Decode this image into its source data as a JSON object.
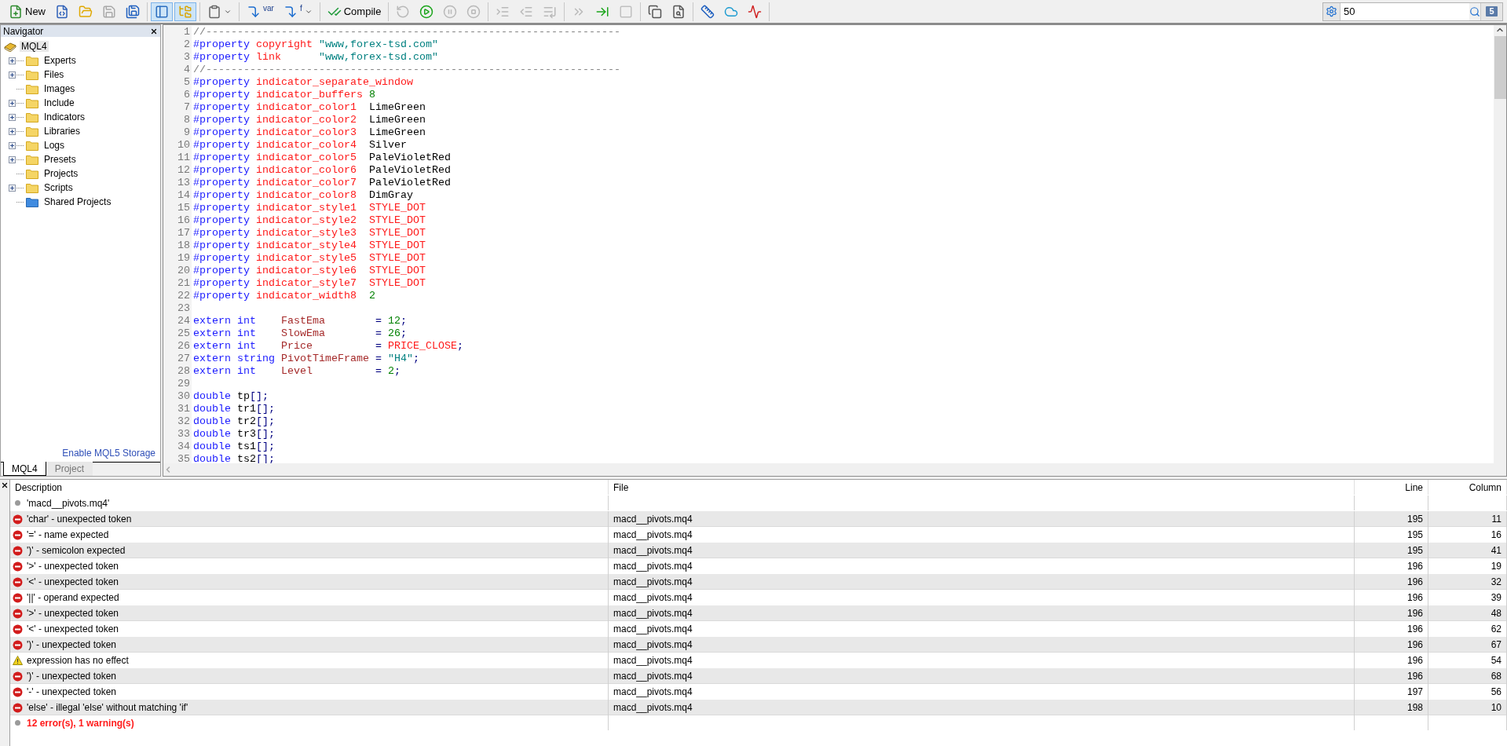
{
  "toolbar": {
    "groups": [
      [
        {
          "kind": "new",
          "label": "New",
          "selected": false,
          "disabled": false
        },
        {
          "kind": "new-project",
          "selected": false,
          "disabled": false
        },
        {
          "kind": "open",
          "selected": false,
          "disabled": false
        },
        {
          "kind": "save",
          "selected": false,
          "disabled": true
        },
        {
          "kind": "save-all",
          "selected": false,
          "disabled": false
        }
      ],
      [
        {
          "kind": "layout",
          "selected": true,
          "disabled": false
        },
        {
          "kind": "folders",
          "selected": true,
          "disabled": false
        }
      ],
      [
        {
          "kind": "clipboard",
          "menu": true,
          "selected": false,
          "disabled": false
        }
      ],
      [
        {
          "kind": "insert",
          "label": "var",
          "selected": false,
          "disabled": false
        },
        {
          "kind": "insert",
          "label": "f",
          "menu": true,
          "selected": false,
          "disabled": false
        }
      ],
      [
        {
          "kind": "compile",
          "label": "Compile",
          "selected": false,
          "disabled": false
        }
      ],
      [
        {
          "kind": "restart",
          "selected": false,
          "disabled": true
        },
        {
          "kind": "play",
          "selected": false,
          "disabled": false
        },
        {
          "kind": "pause",
          "selected": false,
          "disabled": true
        },
        {
          "kind": "stop",
          "selected": false,
          "disabled": true
        }
      ],
      [
        {
          "kind": "step-into",
          "selected": false,
          "disabled": true
        },
        {
          "kind": "step-over",
          "selected": false,
          "disabled": true
        },
        {
          "kind": "step-out",
          "selected": false,
          "disabled": true
        }
      ],
      [
        {
          "kind": "breakpoint",
          "selected": false,
          "disabled": true
        },
        {
          "kind": "run-to",
          "selected": false,
          "disabled": false
        },
        {
          "kind": "halt",
          "selected": false,
          "disabled": true
        }
      ],
      [
        {
          "kind": "copy",
          "selected": false,
          "disabled": false
        },
        {
          "kind": "find",
          "selected": false,
          "disabled": false
        }
      ],
      [
        {
          "kind": "comb",
          "selected": false,
          "disabled": false
        },
        {
          "kind": "cloud",
          "selected": false,
          "disabled": false
        },
        {
          "kind": "chart",
          "selected": false,
          "disabled": false
        }
      ]
    ],
    "search": {
      "value": "50"
    },
    "messages_badge": "5"
  },
  "navigator": {
    "title": "Navigator",
    "root": {
      "label": "MQL4",
      "selected": true
    },
    "items": [
      {
        "label": "Experts",
        "kind": "folder",
        "expandable": true,
        "selected": false
      },
      {
        "label": "Files",
        "kind": "folder",
        "expandable": true,
        "selected": false
      },
      {
        "label": "Images",
        "kind": "folder",
        "expandable": false,
        "selected": false
      },
      {
        "label": "Include",
        "kind": "folder",
        "expandable": true,
        "selected": false
      },
      {
        "label": "Indicators",
        "kind": "folder",
        "expandable": true,
        "selected": false
      },
      {
        "label": "Libraries",
        "kind": "folder",
        "expandable": true,
        "selected": false
      },
      {
        "label": "Logs",
        "kind": "folder",
        "expandable": true,
        "selected": false
      },
      {
        "label": "Presets",
        "kind": "folder",
        "expandable": true,
        "selected": false
      },
      {
        "label": "Projects",
        "kind": "folder",
        "expandable": false,
        "selected": false
      },
      {
        "label": "Scripts",
        "kind": "folder",
        "expandable": true,
        "selected": false
      },
      {
        "label": "Shared Projects",
        "kind": "shared",
        "expandable": false,
        "selected": false
      }
    ],
    "link": "Enable MQL5 Storage",
    "tabs": [
      {
        "label": "MQL4",
        "selected": true
      },
      {
        "label": "Project",
        "selected": false
      }
    ]
  },
  "editor": {
    "lines": [
      {
        "n": "1",
        "tokens": [
          {
            "kind": "comment",
            "text": "//------------------------------------------------------------------"
          }
        ]
      },
      {
        "n": "2",
        "tokens": [
          {
            "kind": "keyword",
            "text": "#property "
          },
          {
            "kind": "property",
            "text": "copyright "
          },
          {
            "kind": "string",
            "text": "\"www,forex-tsd.com\""
          }
        ]
      },
      {
        "n": "3",
        "tokens": [
          {
            "kind": "keyword",
            "text": "#property "
          },
          {
            "kind": "property",
            "text": "link      "
          },
          {
            "kind": "string",
            "text": "\"www,forex-tsd.com\""
          }
        ]
      },
      {
        "n": "4",
        "tokens": [
          {
            "kind": "comment",
            "text": "//------------------------------------------------------------------"
          }
        ]
      },
      {
        "n": "5",
        "tokens": [
          {
            "kind": "keyword",
            "text": "#property "
          },
          {
            "kind": "property",
            "text": "indicator_separate_window"
          }
        ]
      },
      {
        "n": "6",
        "tokens": [
          {
            "kind": "keyword",
            "text": "#property "
          },
          {
            "kind": "property",
            "text": "indicator_buffers "
          },
          {
            "kind": "number",
            "text": "8"
          }
        ]
      },
      {
        "n": "7",
        "tokens": [
          {
            "kind": "keyword",
            "text": "#property "
          },
          {
            "kind": "property",
            "text": "indicator_color1  "
          },
          {
            "kind": "plain",
            "text": "LimeGreen"
          }
        ]
      },
      {
        "n": "8",
        "tokens": [
          {
            "kind": "keyword",
            "text": "#property "
          },
          {
            "kind": "property",
            "text": "indicator_color2  "
          },
          {
            "kind": "plain",
            "text": "LimeGreen"
          }
        ]
      },
      {
        "n": "9",
        "tokens": [
          {
            "kind": "keyword",
            "text": "#property "
          },
          {
            "kind": "property",
            "text": "indicator_color3  "
          },
          {
            "kind": "plain",
            "text": "LimeGreen"
          }
        ]
      },
      {
        "n": "10",
        "tokens": [
          {
            "kind": "keyword",
            "text": "#property "
          },
          {
            "kind": "property",
            "text": "indicator_color4  "
          },
          {
            "kind": "plain",
            "text": "Silver"
          }
        ]
      },
      {
        "n": "11",
        "tokens": [
          {
            "kind": "keyword",
            "text": "#property "
          },
          {
            "kind": "property",
            "text": "indicator_color5  "
          },
          {
            "kind": "plain",
            "text": "PaleVioletRed"
          }
        ]
      },
      {
        "n": "12",
        "tokens": [
          {
            "kind": "keyword",
            "text": "#property "
          },
          {
            "kind": "property",
            "text": "indicator_color6  "
          },
          {
            "kind": "plain",
            "text": "PaleVioletRed"
          }
        ]
      },
      {
        "n": "13",
        "tokens": [
          {
            "kind": "keyword",
            "text": "#property "
          },
          {
            "kind": "property",
            "text": "indicator_color7  "
          },
          {
            "kind": "plain",
            "text": "PaleVioletRed"
          }
        ]
      },
      {
        "n": "14",
        "tokens": [
          {
            "kind": "keyword",
            "text": "#property "
          },
          {
            "kind": "property",
            "text": "indicator_color8  "
          },
          {
            "kind": "plain",
            "text": "DimGray"
          }
        ]
      },
      {
        "n": "15",
        "tokens": [
          {
            "kind": "keyword",
            "text": "#property "
          },
          {
            "kind": "property",
            "text": "indicator_style1  "
          },
          {
            "kind": "constant",
            "text": "STYLE_DOT"
          }
        ]
      },
      {
        "n": "16",
        "tokens": [
          {
            "kind": "keyword",
            "text": "#property "
          },
          {
            "kind": "property",
            "text": "indicator_style2  "
          },
          {
            "kind": "constant",
            "text": "STYLE_DOT"
          }
        ]
      },
      {
        "n": "17",
        "tokens": [
          {
            "kind": "keyword",
            "text": "#property "
          },
          {
            "kind": "property",
            "text": "indicator_style3  "
          },
          {
            "kind": "constant",
            "text": "STYLE_DOT"
          }
        ]
      },
      {
        "n": "18",
        "tokens": [
          {
            "kind": "keyword",
            "text": "#property "
          },
          {
            "kind": "property",
            "text": "indicator_style4  "
          },
          {
            "kind": "constant",
            "text": "STYLE_DOT"
          }
        ]
      },
      {
        "n": "19",
        "tokens": [
          {
            "kind": "keyword",
            "text": "#property "
          },
          {
            "kind": "property",
            "text": "indicator_style5  "
          },
          {
            "kind": "constant",
            "text": "STYLE_DOT"
          }
        ]
      },
      {
        "n": "20",
        "tokens": [
          {
            "kind": "keyword",
            "text": "#property "
          },
          {
            "kind": "property",
            "text": "indicator_style6  "
          },
          {
            "kind": "constant",
            "text": "STYLE_DOT"
          }
        ]
      },
      {
        "n": "21",
        "tokens": [
          {
            "kind": "keyword",
            "text": "#property "
          },
          {
            "kind": "property",
            "text": "indicator_style7  "
          },
          {
            "kind": "constant",
            "text": "STYLE_DOT"
          }
        ]
      },
      {
        "n": "22",
        "tokens": [
          {
            "kind": "keyword",
            "text": "#property "
          },
          {
            "kind": "property",
            "text": "indicator_width8  "
          },
          {
            "kind": "number",
            "text": "2"
          }
        ]
      },
      {
        "n": "23"
      },
      {
        "n": "24",
        "tokens": [
          {
            "kind": "keyword",
            "text": "extern int    "
          },
          {
            "kind": "identifier",
            "text": "FastEma        "
          },
          {
            "kind": "operator",
            "text": "= "
          },
          {
            "kind": "number",
            "text": "12"
          },
          {
            "kind": "operator",
            "text": ";"
          }
        ]
      },
      {
        "n": "25",
        "tokens": [
          {
            "kind": "keyword",
            "text": "extern int    "
          },
          {
            "kind": "identifier",
            "text": "SlowEma        "
          },
          {
            "kind": "operator",
            "text": "= "
          },
          {
            "kind": "number",
            "text": "26"
          },
          {
            "kind": "operator",
            "text": ";"
          }
        ]
      },
      {
        "n": "26",
        "tokens": [
          {
            "kind": "keyword",
            "text": "extern int    "
          },
          {
            "kind": "identifier",
            "text": "Price          "
          },
          {
            "kind": "operator",
            "text": "= "
          },
          {
            "kind": "constant",
            "text": "PRICE_CLOSE"
          },
          {
            "kind": "operator",
            "text": ";"
          }
        ]
      },
      {
        "n": "27",
        "tokens": [
          {
            "kind": "keyword",
            "text": "extern string "
          },
          {
            "kind": "identifier",
            "text": "PivotTimeFrame "
          },
          {
            "kind": "operator",
            "text": "= "
          },
          {
            "kind": "string",
            "text": "\"H4\""
          },
          {
            "kind": "operator",
            "text": ";"
          }
        ]
      },
      {
        "n": "28",
        "tokens": [
          {
            "kind": "keyword",
            "text": "extern int    "
          },
          {
            "kind": "identifier",
            "text": "Level          "
          },
          {
            "kind": "operator",
            "text": "= "
          },
          {
            "kind": "number",
            "text": "2"
          },
          {
            "kind": "operator",
            "text": ";"
          }
        ]
      },
      {
        "n": "29"
      },
      {
        "n": "30",
        "tokens": [
          {
            "kind": "keyword",
            "text": "double "
          },
          {
            "kind": "plain",
            "text": "tp"
          },
          {
            "kind": "operator",
            "text": "[];"
          }
        ]
      },
      {
        "n": "31",
        "tokens": [
          {
            "kind": "keyword",
            "text": "double "
          },
          {
            "kind": "plain",
            "text": "tr1"
          },
          {
            "kind": "operator",
            "text": "[];"
          }
        ]
      },
      {
        "n": "32",
        "tokens": [
          {
            "kind": "keyword",
            "text": "double "
          },
          {
            "kind": "plain",
            "text": "tr2"
          },
          {
            "kind": "operator",
            "text": "[];"
          }
        ]
      },
      {
        "n": "33",
        "tokens": [
          {
            "kind": "keyword",
            "text": "double "
          },
          {
            "kind": "plain",
            "text": "tr3"
          },
          {
            "kind": "operator",
            "text": "[];"
          }
        ]
      },
      {
        "n": "34",
        "tokens": [
          {
            "kind": "keyword",
            "text": "double "
          },
          {
            "kind": "plain",
            "text": "ts1"
          },
          {
            "kind": "operator",
            "text": "[];"
          }
        ]
      },
      {
        "n": "35",
        "tokens": [
          {
            "kind": "keyword",
            "text": "double "
          },
          {
            "kind": "plain",
            "text": "ts2"
          },
          {
            "kind": "operator",
            "text": "[];"
          }
        ]
      }
    ]
  },
  "errors": {
    "columns": [
      "Description",
      "File",
      "Line",
      "Column"
    ],
    "rows": [
      {
        "kind": "info",
        "description": "'macd__pivots.mq4'"
      },
      {
        "kind": "error",
        "description": "'char' - unexpected token",
        "file": "macd__pivots.mq4",
        "line": "195",
        "column": "11"
      },
      {
        "kind": "error",
        "description": "'=' - name expected",
        "file": "macd__pivots.mq4",
        "line": "195",
        "column": "16"
      },
      {
        "kind": "error",
        "description": "')' - semicolon expected",
        "file": "macd__pivots.mq4",
        "line": "195",
        "column": "41"
      },
      {
        "kind": "error",
        "description": "'>' - unexpected token",
        "file": "macd__pivots.mq4",
        "line": "196",
        "column": "19"
      },
      {
        "kind": "error",
        "description": "'<' - unexpected token",
        "file": "macd__pivots.mq4",
        "line": "196",
        "column": "32"
      },
      {
        "kind": "error",
        "description": "'||' - operand expected",
        "file": "macd__pivots.mq4",
        "line": "196",
        "column": "39"
      },
      {
        "kind": "error",
        "description": "'>' - unexpected token",
        "file": "macd__pivots.mq4",
        "line": "196",
        "column": "48"
      },
      {
        "kind": "error",
        "description": "'<' - unexpected token",
        "file": "macd__pivots.mq4",
        "line": "196",
        "column": "62"
      },
      {
        "kind": "error",
        "description": "')' - unexpected token",
        "file": "macd__pivots.mq4",
        "line": "196",
        "column": "67"
      },
      {
        "kind": "warning",
        "description": "expression has no effect",
        "file": "macd__pivots.mq4",
        "line": "196",
        "column": "54"
      },
      {
        "kind": "error",
        "description": "')' - unexpected token",
        "file": "macd__pivots.mq4",
        "line": "196",
        "column": "68"
      },
      {
        "kind": "error",
        "description": "'-' - unexpected token",
        "file": "macd__pivots.mq4",
        "line": "197",
        "column": "56"
      },
      {
        "kind": "error",
        "description": "'else' - illegal 'else' without matching 'if'",
        "file": "macd__pivots.mq4",
        "line": "198",
        "column": "10"
      },
      {
        "kind": "summary",
        "description": "12 error(s), 1 warning(s)"
      }
    ]
  }
}
